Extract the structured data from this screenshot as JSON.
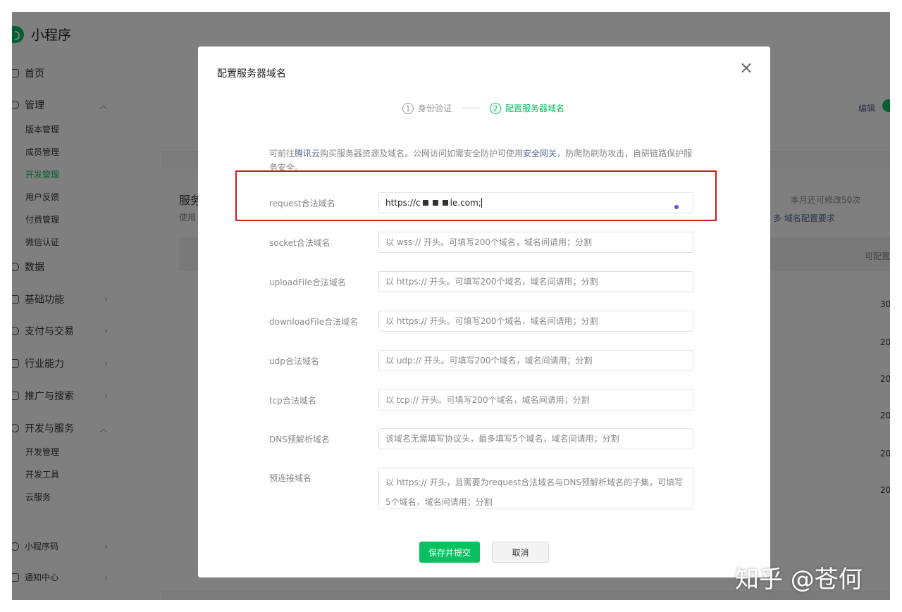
{
  "sidebar": {
    "brand": "小程序",
    "home": "首页",
    "manage": "管理",
    "manage_sub": [
      "版本管理",
      "成员管理",
      "开发管理",
      "用户反馈",
      "付费管理",
      "微信认证"
    ],
    "data": "数据",
    "basic": "基础功能",
    "payment": "支付与交易",
    "industry": "行业能力",
    "promo": "推广与搜索",
    "devsvc": "开发与服务",
    "devsvc_sub": [
      "开发管理",
      "开发工具",
      "云服务"
    ],
    "qrcode": "小程序码",
    "notify": "通知中心"
  },
  "background": {
    "edit": "编辑",
    "section_title": "服务",
    "section_desc": "使用",
    "monthly_quota": "本月还可修改50次",
    "domain_req_link": "多 域名配置要求",
    "col_header": "可配置",
    "row_values": [
      "30",
      "20",
      "20",
      "20",
      "20",
      "20"
    ]
  },
  "dialog": {
    "title": "配置服务器域名",
    "close_label": "×",
    "step1_num": "1",
    "step1_label": "身份验证",
    "step2_num": "2",
    "step2_label": "配置服务器域名",
    "notice_prefix": "可前往",
    "notice_link1": "腾讯云",
    "notice_mid": "购买服务器资源及域名。公网访问如需安全防护可使用",
    "notice_link2": "安全网关",
    "notice_suffix": "，防爬防刷防攻击，自研链路保护服务安全。",
    "fields": {
      "request": {
        "label": "request合法域名",
        "value_prefix": "https://c",
        "value_suffix": "le.com;"
      },
      "socket": {
        "label": "socket合法域名",
        "placeholder": "以 wss:// 开头。可填写200个域名，域名间请用；分割"
      },
      "upload": {
        "label": "uploadFile合法域名",
        "placeholder": "以 https:// 开头。可填写200个域名，域名间请用；分割"
      },
      "download": {
        "label": "downloadFile合法域名",
        "placeholder": "以 https:// 开头。可填写200个域名，域名间请用；分割"
      },
      "udp": {
        "label": "udp合法域名",
        "placeholder": "以 udp:// 开头。可填写200个域名，域名间请用；分割"
      },
      "tcp": {
        "label": "tcp合法域名",
        "placeholder": "以 tcp:// 开头。可填写200个域名，域名间请用；分割"
      },
      "dns": {
        "label": "DNS预解析域名",
        "placeholder": "该域名无需填写协议头，最多填写5个域名，域名间请用；分割"
      },
      "preconnect": {
        "label": "预连接域名",
        "placeholder": "以 https:// 开头，且需要为request合法域名与DNS预解析域名的子集，可填写5个域名，域名间请用；分割"
      }
    },
    "save_label": "保存并提交",
    "cancel_label": "取消"
  },
  "watermark": "知乎 @苍何",
  "colors": {
    "brand_green": "#07c160",
    "link": "#576b95",
    "highlight_red": "#d9161c"
  }
}
